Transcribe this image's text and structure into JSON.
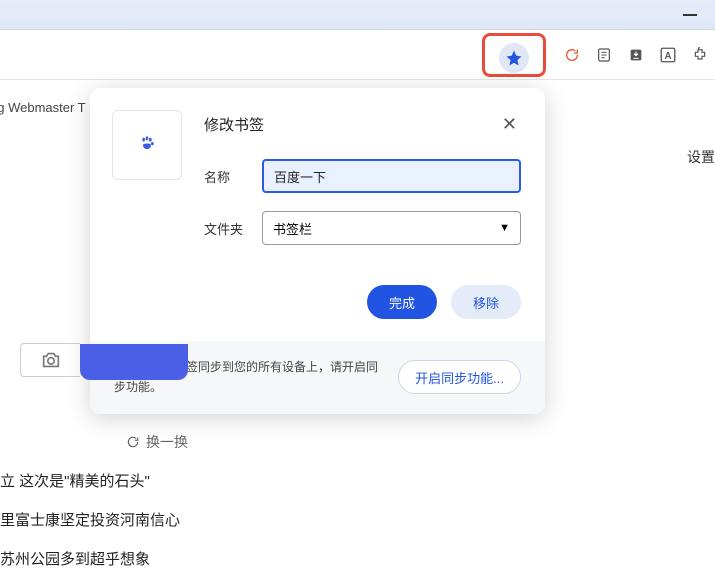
{
  "page": {
    "bookmarks_bar_text": "ng Webmaster T",
    "settings": "设置"
  },
  "popup": {
    "title": "修改书签",
    "name_label": "名称",
    "name_value": "百度一下",
    "folder_label": "文件夹",
    "folder_value": "书签栏",
    "done_button": "完成",
    "remove_button": "移除",
    "sync_message": "要想将您的书签同步到您的所有设备上，请开启同步功能。",
    "sync_button": "开启同步功能..."
  },
  "refresh": {
    "label": "换一换"
  },
  "news": {
    "items": [
      "立 这次是\"精美的石头\"",
      "里富士康坚定投资河南信心",
      "苏州公园多到超乎想象"
    ]
  }
}
